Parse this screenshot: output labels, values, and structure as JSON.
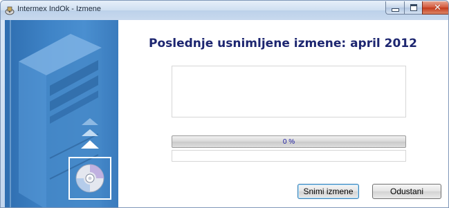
{
  "window": {
    "title": "Intermex IndOk - Izmene",
    "app_icon": "installer-icon",
    "buttons": {
      "minimize": "minimize-icon",
      "maximize": "maximize-icon",
      "close": "close-icon"
    }
  },
  "main": {
    "headline": "Poslednje usnimljene izmene: april 2012",
    "info_text": "",
    "progress": {
      "percent": 0,
      "label": "0 %"
    },
    "status_text": ""
  },
  "sidebar": {
    "icons": [
      "computer-tower-icon",
      "upload-arrows-icon",
      "disc-icon"
    ]
  },
  "actions": {
    "save_label": "Snimi izmene",
    "cancel_label": "Odustani"
  },
  "colors": {
    "headline": "#1d2670",
    "sidebar_blue": "#3f84c7",
    "progress_text": "#1a1aa0"
  }
}
